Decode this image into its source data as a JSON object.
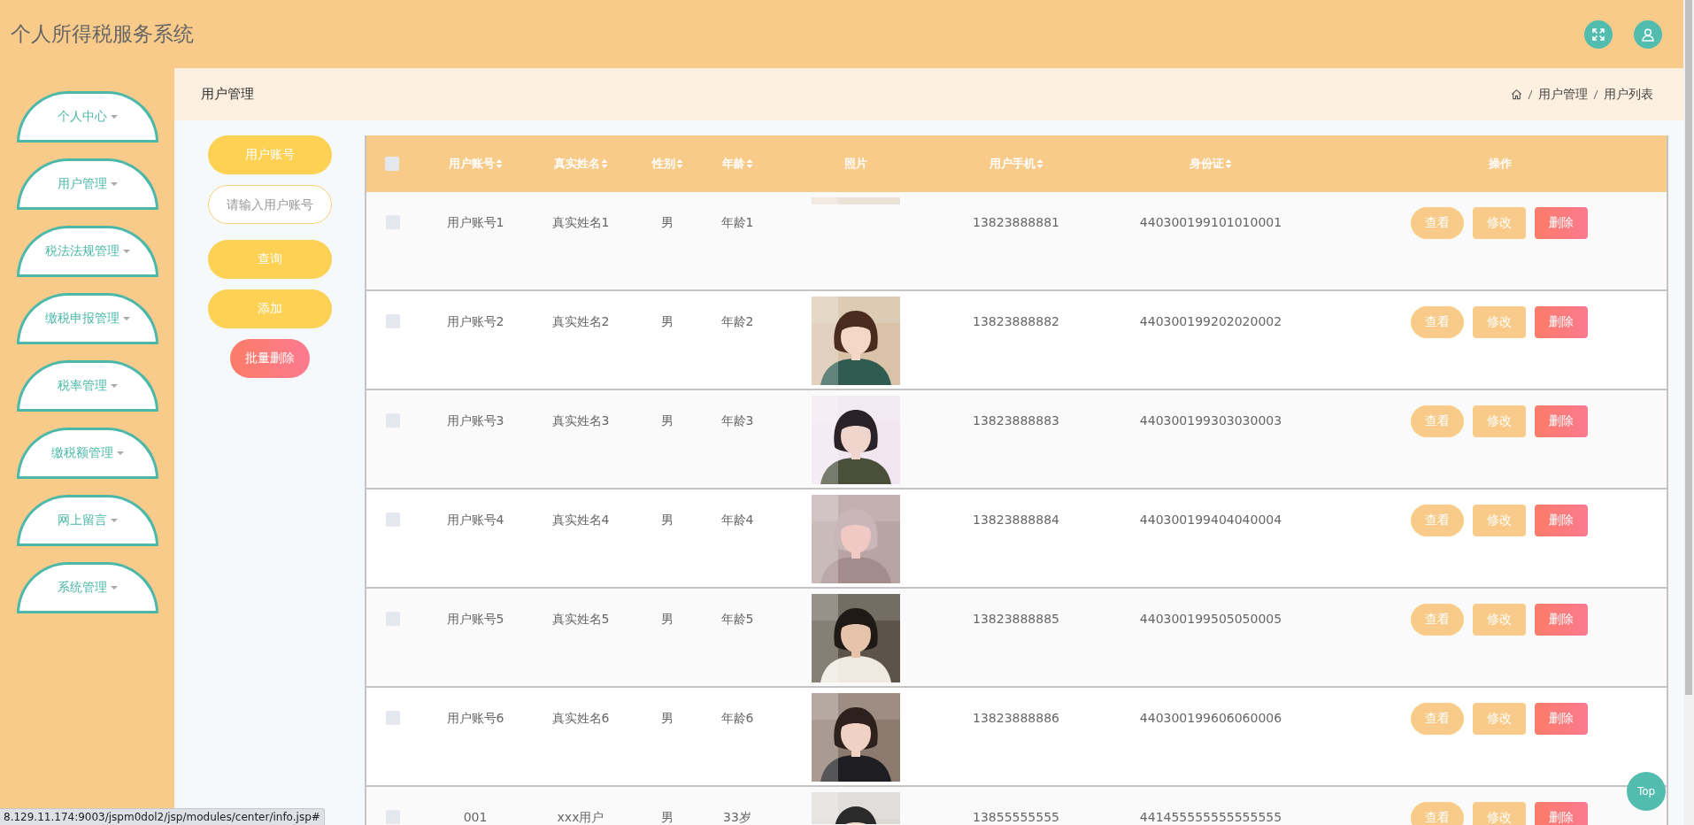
{
  "app": {
    "title": "个人所得税服务系统"
  },
  "sidebar": {
    "items": [
      {
        "label": "个人中心"
      },
      {
        "label": "用户管理"
      },
      {
        "label": "税法法规管理"
      },
      {
        "label": "缴税申报管理"
      },
      {
        "label": "税率管理"
      },
      {
        "label": "缴税额管理"
      },
      {
        "label": "网上留言"
      },
      {
        "label": "系统管理"
      }
    ]
  },
  "page_header": {
    "title": "用户管理",
    "breadcrumb": [
      "用户管理",
      "用户列表"
    ]
  },
  "search": {
    "field_label": "用户账号",
    "placeholder": "请输入用户账号",
    "buttons": [
      {
        "label": "查询",
        "kind": "primary"
      },
      {
        "label": "添加",
        "kind": "primary"
      },
      {
        "label": "批量删除",
        "kind": "danger"
      }
    ]
  },
  "table": {
    "columns": [
      {
        "kind": "checkbox",
        "checked": false
      },
      {
        "kind": "text",
        "label": "用户账号",
        "sortable": true
      },
      {
        "kind": "text",
        "label": "真实姓名",
        "sortable": true
      },
      {
        "kind": "text",
        "label": "性别",
        "sortable": true
      },
      {
        "kind": "text",
        "label": "年龄",
        "sortable": true
      },
      {
        "kind": "text",
        "label": "照片",
        "sortable": false
      },
      {
        "kind": "text",
        "label": "用户手机",
        "sortable": true
      },
      {
        "kind": "text",
        "label": "身份证",
        "sortable": true
      },
      {
        "kind": "text",
        "label": "操作",
        "sortable": false
      }
    ],
    "rows": [
      {
        "checked": false,
        "account": "用户账号1",
        "real_name": "真实姓名1",
        "sex": "男",
        "age": "年龄1",
        "photo": {
          "kind": "picture",
          "partial": true
        },
        "phone": "13823888881",
        "id_card": "440300199101010001",
        "actions": [
          {
            "label": "查看",
            "kind": "view"
          },
          {
            "label": "修改",
            "kind": "edit"
          },
          {
            "label": "删除",
            "kind": "delete"
          }
        ]
      },
      {
        "checked": false,
        "account": "用户账号2",
        "real_name": "真实姓名2",
        "sex": "男",
        "age": "年龄2",
        "photo": {
          "kind": "picture",
          "partial": false
        },
        "phone": "13823888882",
        "id_card": "440300199202020002",
        "actions": [
          {
            "label": "查看",
            "kind": "view"
          },
          {
            "label": "修改",
            "kind": "edit"
          },
          {
            "label": "删除",
            "kind": "delete"
          }
        ]
      },
      {
        "checked": false,
        "account": "用户账号3",
        "real_name": "真实姓名3",
        "sex": "男",
        "age": "年龄3",
        "photo": {
          "kind": "picture",
          "partial": false
        },
        "phone": "13823888883",
        "id_card": "440300199303030003",
        "actions": [
          {
            "label": "查看",
            "kind": "view"
          },
          {
            "label": "修改",
            "kind": "edit"
          },
          {
            "label": "删除",
            "kind": "delete"
          }
        ]
      },
      {
        "checked": false,
        "account": "用户账号4",
        "real_name": "真实姓名4",
        "sex": "男",
        "age": "年龄4",
        "photo": {
          "kind": "picture",
          "partial": false
        },
        "phone": "13823888884",
        "id_card": "440300199404040004",
        "actions": [
          {
            "label": "查看",
            "kind": "view"
          },
          {
            "label": "修改",
            "kind": "edit"
          },
          {
            "label": "删除",
            "kind": "delete"
          }
        ]
      },
      {
        "checked": false,
        "account": "用户账号5",
        "real_name": "真实姓名5",
        "sex": "男",
        "age": "年龄5",
        "photo": {
          "kind": "picture",
          "partial": false
        },
        "phone": "13823888885",
        "id_card": "440300199505050005",
        "actions": [
          {
            "label": "查看",
            "kind": "view"
          },
          {
            "label": "修改",
            "kind": "edit"
          },
          {
            "label": "删除",
            "kind": "delete"
          }
        ]
      },
      {
        "checked": false,
        "account": "用户账号6",
        "real_name": "真实姓名6",
        "sex": "男",
        "age": "年龄6",
        "photo": {
          "kind": "picture",
          "partial": false
        },
        "phone": "13823888886",
        "id_card": "440300199606060006",
        "actions": [
          {
            "label": "查看",
            "kind": "view"
          },
          {
            "label": "修改",
            "kind": "edit"
          },
          {
            "label": "删除",
            "kind": "delete"
          }
        ]
      },
      {
        "checked": false,
        "account": "001",
        "real_name": "xxx用户",
        "sex": "男",
        "age": "33岁",
        "photo": {
          "kind": "picture",
          "partial": false
        },
        "phone": "13855555555",
        "id_card": "441455555555555555",
        "actions": [
          {
            "label": "查看",
            "kind": "view"
          },
          {
            "label": "修改",
            "kind": "edit"
          },
          {
            "label": "删除",
            "kind": "delete"
          }
        ]
      }
    ]
  },
  "back_to_top": {
    "label": "Top"
  },
  "status_bar": {
    "url": "8.129.11.174:9003/jspm0dol2/jsp/modules/center/info.jsp#"
  }
}
